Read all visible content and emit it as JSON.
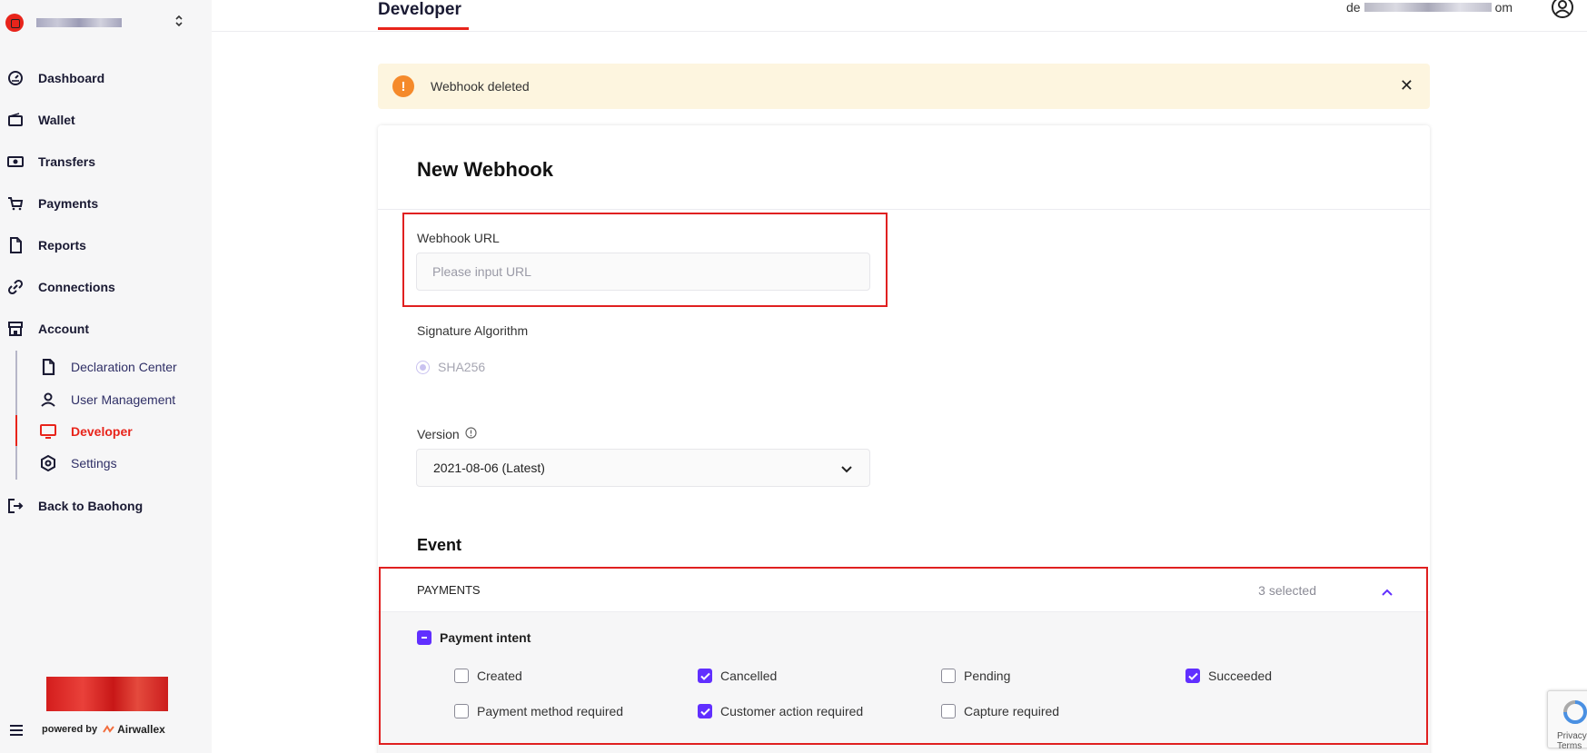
{
  "sidebar": {
    "items": [
      {
        "label": "Dashboard",
        "icon": "gauge-icon"
      },
      {
        "label": "Wallet",
        "icon": "wallet-icon"
      },
      {
        "label": "Transfers",
        "icon": "banknote-icon"
      },
      {
        "label": "Payments",
        "icon": "cart-icon"
      },
      {
        "label": "Reports",
        "icon": "document-icon"
      },
      {
        "label": "Connections",
        "icon": "link-icon"
      },
      {
        "label": "Account",
        "icon": "store-icon"
      }
    ],
    "sub_items": [
      {
        "label": "Declaration Center",
        "icon": "document-icon"
      },
      {
        "label": "User Management",
        "icon": "user-icon"
      },
      {
        "label": "Developer",
        "icon": "monitor-icon",
        "active": true
      },
      {
        "label": "Settings",
        "icon": "settings-icon"
      }
    ],
    "back": {
      "label": "Back to Baohong",
      "icon": "logout-icon"
    },
    "powered_by": "powered by",
    "brand": "Airwallex"
  },
  "header": {
    "tab": "Developer",
    "email_start": "de",
    "email_end": "om"
  },
  "alert": {
    "message": "Webhook deleted",
    "close": "✕"
  },
  "form": {
    "title": "New Webhook",
    "url_label": "Webhook URL",
    "url_placeholder": "Please input URL",
    "url_value": "",
    "signature_label": "Signature Algorithm",
    "signature_option": "SHA256",
    "version_label": "Version",
    "version_value": "2021-08-06 (Latest)",
    "event_title": "Event"
  },
  "events": {
    "group_title": "PAYMENTS",
    "selected_count": "3 selected",
    "subgroup": "Payment intent",
    "items": [
      {
        "label": "Created",
        "checked": false
      },
      {
        "label": "Cancelled",
        "checked": true
      },
      {
        "label": "Pending",
        "checked": false
      },
      {
        "label": "Succeeded",
        "checked": true
      },
      {
        "label": "Payment method required",
        "checked": false
      },
      {
        "label": "Customer action required",
        "checked": true
      },
      {
        "label": "Capture required",
        "checked": false
      }
    ]
  },
  "recaptcha": {
    "text": "Privacy - Terms"
  },
  "colors": {
    "accent_red": "#e8241b",
    "accent_purple": "#612fff",
    "alert_bg": "#fdf5df",
    "warning_orange": "#f58a2b"
  }
}
